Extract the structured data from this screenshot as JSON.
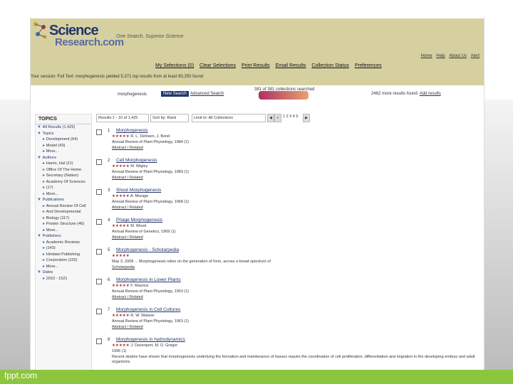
{
  "footer": "fppt.com",
  "logo": {
    "word1": "Science",
    "word2": "Research.com"
  },
  "tagline": "One Search. Superior Science",
  "toplinks": [
    "Home",
    "Help",
    "About Us",
    "Alert"
  ],
  "nav": [
    "My Selections (0)",
    "Clear Selections",
    "Print Results",
    "Email Results",
    "Collection Status",
    "Preferences"
  ],
  "session": "Your session: Full Text: morphogenesis yielded 5,371 top results from at least 90,250 found",
  "search": {
    "query": "morphogenesis",
    "button": "New Search",
    "advanced": "Advanced Search"
  },
  "relevance": "381 of 381 collections searched",
  "more": {
    "count": "2462 more results found.",
    "link": "Add results"
  },
  "topics": {
    "title": "TOPICS",
    "items": [
      {
        "text": "All Results (1,425)",
        "kind": "head"
      },
      {
        "text": "Topics",
        "kind": "head"
      },
      {
        "text": "Development (64)",
        "kind": "sub"
      },
      {
        "text": "Model (43)",
        "kind": "sub"
      },
      {
        "text": "More...",
        "kind": "sub"
      },
      {
        "text": "Authors",
        "kind": "head"
      },
      {
        "text": "Hamn, Hal (21)",
        "kind": "sub"
      },
      {
        "text": "Office Of The Home",
        "kind": "sub"
      },
      {
        "text": "Secretary (Nation)",
        "kind": "sub"
      },
      {
        "text": "Academy Of Sciences",
        "kind": "sub"
      },
      {
        "text": "(17)",
        "kind": "sub"
      },
      {
        "text": "More...",
        "kind": "sub"
      },
      {
        "text": "Publications",
        "kind": "head"
      },
      {
        "text": "Annual Review Of Cell",
        "kind": "sub"
      },
      {
        "text": "And Developmental",
        "kind": "sub"
      },
      {
        "text": "Biology (117)",
        "kind": "sub"
      },
      {
        "text": "Protein Structure (46)",
        "kind": "sub"
      },
      {
        "text": "More...",
        "kind": "sub"
      },
      {
        "text": "Publishers",
        "kind": "head"
      },
      {
        "text": "Academic Reviews",
        "kind": "sub"
      },
      {
        "text": "(143)",
        "kind": "sub"
      },
      {
        "text": "Hindawi Publishing",
        "kind": "sub"
      },
      {
        "text": "Corporation (102)",
        "kind": "sub"
      },
      {
        "text": "More...",
        "kind": "sub"
      },
      {
        "text": "Dates",
        "kind": "head"
      },
      {
        "text": "2010 - 1521",
        "kind": "sub"
      }
    ]
  },
  "toolbar": {
    "results": "Results 1 - 10 of 1,425",
    "sort": "Sort by: Rank",
    "limit": "Limit to: All Collections",
    "pages": "1 2 3 4 5"
  },
  "results": [
    {
      "n": "1",
      "title": "Morphogenesis",
      "author": "R. L. Dehlsen, J. Bond",
      "source": "Annual Review of Plant Physiology, 1984 (1)"
    },
    {
      "n": "2",
      "title": "Cell Morphogenesis",
      "author": "M. Wigley",
      "source": "Annual Review of Plant Physiology, 1983 (1)"
    },
    {
      "n": "3",
      "title": "Shoot Morphogenesis",
      "author": "A. Murage",
      "source": "Annual Review of Plant Physiology, 1968 (1)"
    },
    {
      "n": "4",
      "title": "Phage Morphogenesis",
      "author": "M. Wood",
      "source": "Annual Review of Genetics, 1969 (1)"
    },
    {
      "n": "5",
      "title": "Morphogenesis - Scholarpedia",
      "author": "",
      "source": "May 3, 2008 ... Morphogenesis relies on the generation of form, across a broad spectrum of",
      "extra": "Scholarpedia"
    },
    {
      "n": "6",
      "title": "Morphogenesis in Lower Plants",
      "author": "F. Maurice",
      "source": "Annual Review of Plant Physiology, 1953 (1)"
    },
    {
      "n": "7",
      "title": "Morphogenesis in Cell Cultures",
      "author": "R. W. Watson",
      "source": "Annual Review of Plant Physiology, 1963 (1)"
    },
    {
      "n": "8",
      "title": "Morphogenesis in hydrodynamics",
      "author": "J. Davenport, M. D. Gregor",
      "source": "1995 (1)"
    }
  ],
  "detailsLabel": "Abstract / Related",
  "description": "Recent studies have shown that morphogenesis underlying the formation and maintenance of tissues require the coordination of cell proliferation, differentiation and migration in the developing embryo and adult organisms."
}
